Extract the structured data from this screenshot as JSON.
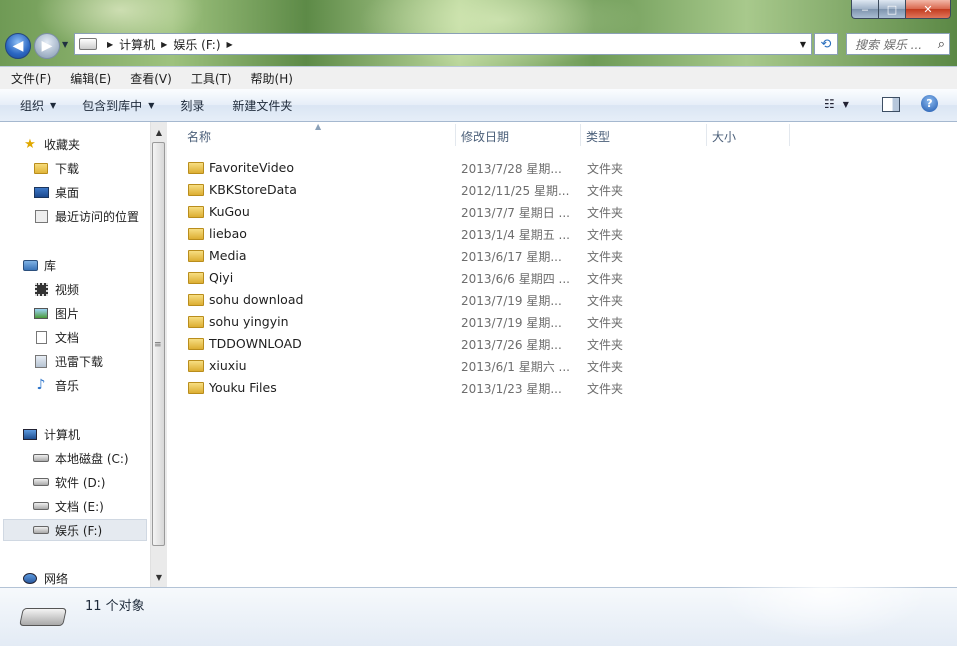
{
  "window": {
    "caption": {
      "minimize": "‒",
      "maximize": "□",
      "close": "✕"
    }
  },
  "addressbar": {
    "crumbs": [
      "计算机",
      "娱乐 (F:)"
    ],
    "search_placeholder": "搜索 娱乐 ..."
  },
  "menubar": {
    "items": [
      "文件(F)",
      "编辑(E)",
      "查看(V)",
      "工具(T)",
      "帮助(H)"
    ]
  },
  "commandbar": {
    "organize": "组织",
    "include_in_library": "包含到库中",
    "burn": "刻录",
    "new_folder": "新建文件夹"
  },
  "navpane": {
    "favorites": {
      "label": "收藏夹",
      "items": [
        "下载",
        "桌面",
        "最近访问的位置"
      ]
    },
    "libraries": {
      "label": "库",
      "items": [
        "视频",
        "图片",
        "文档",
        "迅雷下载",
        "音乐"
      ]
    },
    "computer": {
      "label": "计算机",
      "items": [
        "本地磁盘 (C:)",
        "软件 (D:)",
        "文档 (E:)",
        "娱乐 (F:)"
      ]
    },
    "network": {
      "label": "网络"
    },
    "selected": "娱乐 (F:)"
  },
  "filelist": {
    "columns": {
      "name": "名称",
      "modified": "修改日期",
      "type": "类型",
      "size": "大小"
    },
    "rows": [
      {
        "name": "FavoriteVideo",
        "modified": "2013/7/28 星期...",
        "type": "文件夹"
      },
      {
        "name": "KBKStoreData",
        "modified": "2012/11/25 星期...",
        "type": "文件夹"
      },
      {
        "name": "KuGou",
        "modified": "2013/7/7 星期日 ...",
        "type": "文件夹"
      },
      {
        "name": "liebao",
        "modified": "2013/1/4 星期五 ...",
        "type": "文件夹"
      },
      {
        "name": "Media",
        "modified": "2013/6/17 星期...",
        "type": "文件夹"
      },
      {
        "name": "Qiyi",
        "modified": "2013/6/6 星期四 ...",
        "type": "文件夹"
      },
      {
        "name": "sohu download",
        "modified": "2013/7/19 星期...",
        "type": "文件夹"
      },
      {
        "name": "sohu yingyin",
        "modified": "2013/7/19 星期...",
        "type": "文件夹"
      },
      {
        "name": "TDDOWNLOAD",
        "modified": "2013/7/26 星期...",
        "type": "文件夹"
      },
      {
        "name": "xiuxiu",
        "modified": "2013/6/1 星期六 ...",
        "type": "文件夹"
      },
      {
        "name": "Youku Files",
        "modified": "2013/1/23 星期...",
        "type": "文件夹"
      }
    ]
  },
  "details": {
    "count_text": "11 个对象"
  },
  "icons": {
    "back": "back-arrow-icon",
    "forward": "forward-arrow-icon",
    "refresh": "refresh-icon",
    "search": "search-icon",
    "help": "help-icon"
  }
}
